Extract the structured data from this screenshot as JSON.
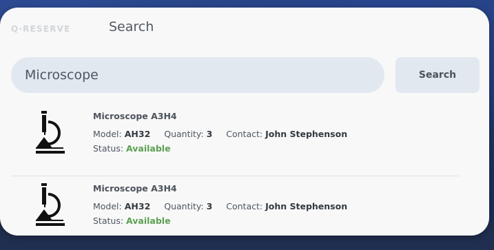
{
  "app": {
    "brand": "Q·RESERVE",
    "page_title": "Search"
  },
  "search": {
    "value": "Microscope",
    "button_label": "Search"
  },
  "labels": {
    "model": "Model:",
    "quantity": "Quantity:",
    "contact": "Contact:",
    "status": "Status:"
  },
  "results": [
    {
      "icon": "microscope-icon",
      "name": "Microscope A3H4",
      "model": "AH32",
      "quantity": "3",
      "contact": "John Stephenson",
      "status": "Available"
    },
    {
      "icon": "microscope-icon",
      "name": "Microscope A3H4",
      "model": "AH32",
      "quantity": "3",
      "contact": "John Stephenson",
      "status": "Available"
    }
  ],
  "colors": {
    "status_available": "#5a9f4f",
    "card_background": "#f8f8f8",
    "input_background": "#e2e8ef"
  }
}
